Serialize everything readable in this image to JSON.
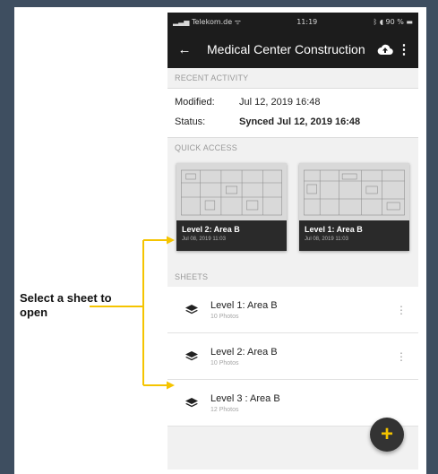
{
  "status_bar": {
    "carrier": "Telekom.de",
    "time": "11:19",
    "battery": "90 %"
  },
  "app_bar": {
    "title": "Medical Center Construction"
  },
  "recent_activity": {
    "header": "RECENT ACTIVITY",
    "modified_label": "Modified:",
    "modified_value": "Jul 12, 2019 16:48",
    "status_label": "Status:",
    "status_value": "Synced Jul 12, 2019 16:48"
  },
  "quick_access": {
    "header": "QUICK ACCESS",
    "cards": [
      {
        "name": "Level 2: Area B",
        "date": "Jul 08, 2019 11:03"
      },
      {
        "name": "Level 1: Area B",
        "date": "Jul 08, 2019 11:03"
      }
    ]
  },
  "sheets": {
    "header": "SHEETS",
    "items": [
      {
        "name": "Level 1: Area B",
        "count": "10 Photos"
      },
      {
        "name": "Level 2: Area B",
        "count": "10 Photos"
      },
      {
        "name": "Level 3 : Area B",
        "count": "12 Photos"
      }
    ]
  },
  "annotation": {
    "text": "Select a sheet to open",
    "color": "#f5c400"
  },
  "colors": {
    "appbar": "#1c1c1c",
    "accent": "#f2c200",
    "background": "#3e4e60"
  },
  "icons": [
    "back-arrow-icon",
    "cloud-upload-icon",
    "more-vert-icon",
    "layers-icon",
    "plus-icon"
  ]
}
